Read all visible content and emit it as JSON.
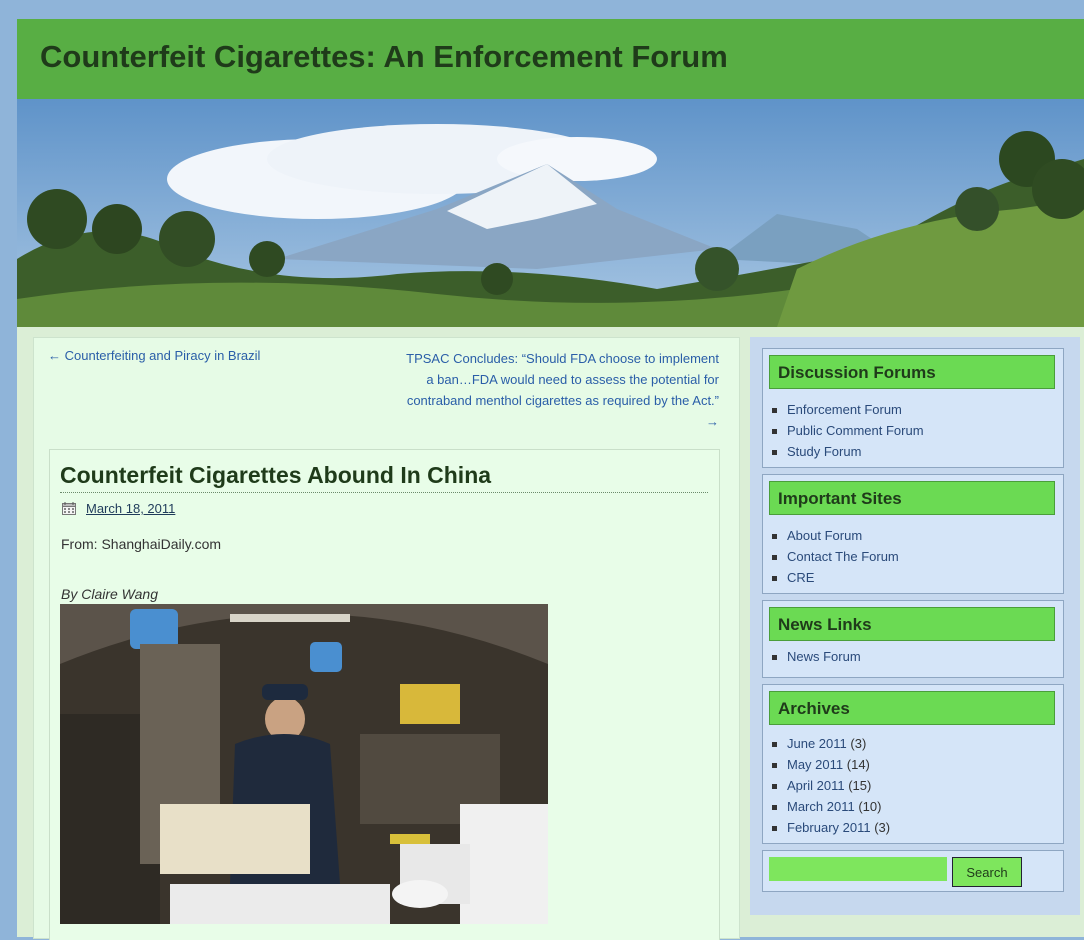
{
  "site": {
    "title": "Counterfeit Cigarettes: An Enforcement Forum"
  },
  "nav": {
    "prev": "← Counterfeiting and Piracy in Brazil",
    "next": "TPSAC Concludes: “Should FDA choose to implement a ban…FDA would need to assess the potential for contraband menthol cigarettes as required by the Act.” →"
  },
  "post": {
    "title": "Counterfeit Cigarettes Abound In China",
    "date": "March 18, 2011",
    "source": "From: ShanghaiDaily.com",
    "author": "By Claire Wang"
  },
  "sidebar": {
    "discussion": {
      "title": "Discussion Forums",
      "items": [
        "Enforcement Forum",
        "Public Comment Forum",
        "Study Forum"
      ]
    },
    "important": {
      "title": "Important Sites",
      "items": [
        "About Forum",
        "Contact The Forum",
        "CRE"
      ]
    },
    "news": {
      "title": "News Links",
      "items": [
        "News Forum"
      ]
    },
    "archives": {
      "title": "Archives",
      "items": [
        {
          "label": "June 2011",
          "count": "(3)"
        },
        {
          "label": "May 2011",
          "count": "(14)"
        },
        {
          "label": "April 2011",
          "count": "(15)"
        },
        {
          "label": "March 2011",
          "count": "(10)"
        },
        {
          "label": "February 2011",
          "count": "(3)"
        }
      ]
    },
    "search": {
      "button_label": "Search",
      "value": ""
    }
  },
  "colors": {
    "header": "#58ae44",
    "widget_title": "#6bda53",
    "link": "#2a5ea8"
  }
}
